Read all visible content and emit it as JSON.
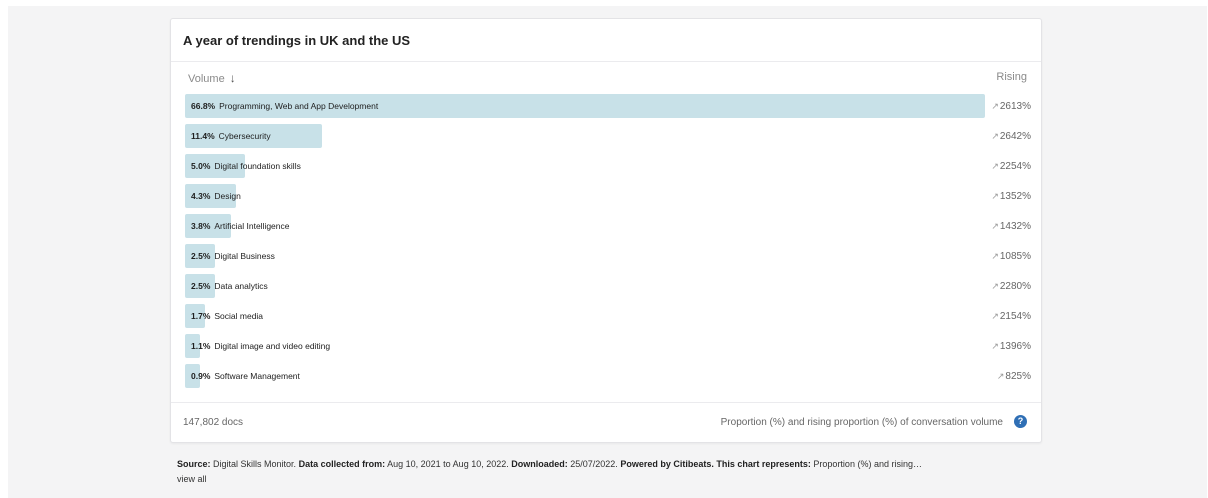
{
  "card": {
    "title": "A year of trendings in UK and the US",
    "col_volume": "Volume",
    "col_volume_arrow": "↓",
    "col_rising": "Rising",
    "docs": "147,802 docs",
    "note": "Proportion (%) and rising proportion (%) of conversation volume",
    "help_icon": "question-mark",
    "accent": "#2f6fb5",
    "bar_color": "#c8e1e8"
  },
  "rows": [
    {
      "pct": "66.8%",
      "label": "Programming, Web and App Development",
      "rise": "2613%",
      "rise_arrow": "↗",
      "value": 66.8
    },
    {
      "pct": "11.4%",
      "label": "Cybersecurity",
      "rise": "2642%",
      "rise_arrow": "↗",
      "value": 11.4
    },
    {
      "pct": "5.0%",
      "label": "Digital foundation skills",
      "rise": "2254%",
      "rise_arrow": "↗",
      "value": 5.0
    },
    {
      "pct": "4.3%",
      "label": "Design",
      "rise": "1352%",
      "rise_arrow": "↗",
      "value": 4.3
    },
    {
      "pct": "3.8%",
      "label": "Artificial Intelligence",
      "rise": "1432%",
      "rise_arrow": "↗",
      "value": 3.8
    },
    {
      "pct": "2.5%",
      "label": "Digital Business",
      "rise": "1085%",
      "rise_arrow": "↗",
      "value": 2.5
    },
    {
      "pct": "2.5%",
      "label": "Data analytics",
      "rise": "2280%",
      "rise_arrow": "↗",
      "value": 2.5
    },
    {
      "pct": "1.7%",
      "label": "Social media",
      "rise": "2154%",
      "rise_arrow": "↗",
      "value": 1.7
    },
    {
      "pct": "1.1%",
      "label": "Digital image and video editing",
      "rise": "1396%",
      "rise_arrow": "↗",
      "value": 1.1
    },
    {
      "pct": "0.9%",
      "label": "Software Management",
      "rise": "825%",
      "rise_arrow": "↗",
      "value": 0.9
    }
  ],
  "source": {
    "source_label": "Source:",
    "source_value": "Digital Skills Monitor.",
    "collected_label": "Data collected from:",
    "collected_value": "Aug 10, 2021 to Aug 10, 2022.",
    "downloaded_label": "Downloaded:",
    "downloaded_value": "25/07/2022.",
    "powered_label": "Powered by Citibeats.",
    "represents_label": "This chart represents:",
    "represents_value": "Proportion (%) and rising…",
    "view_all": "view all"
  }
}
